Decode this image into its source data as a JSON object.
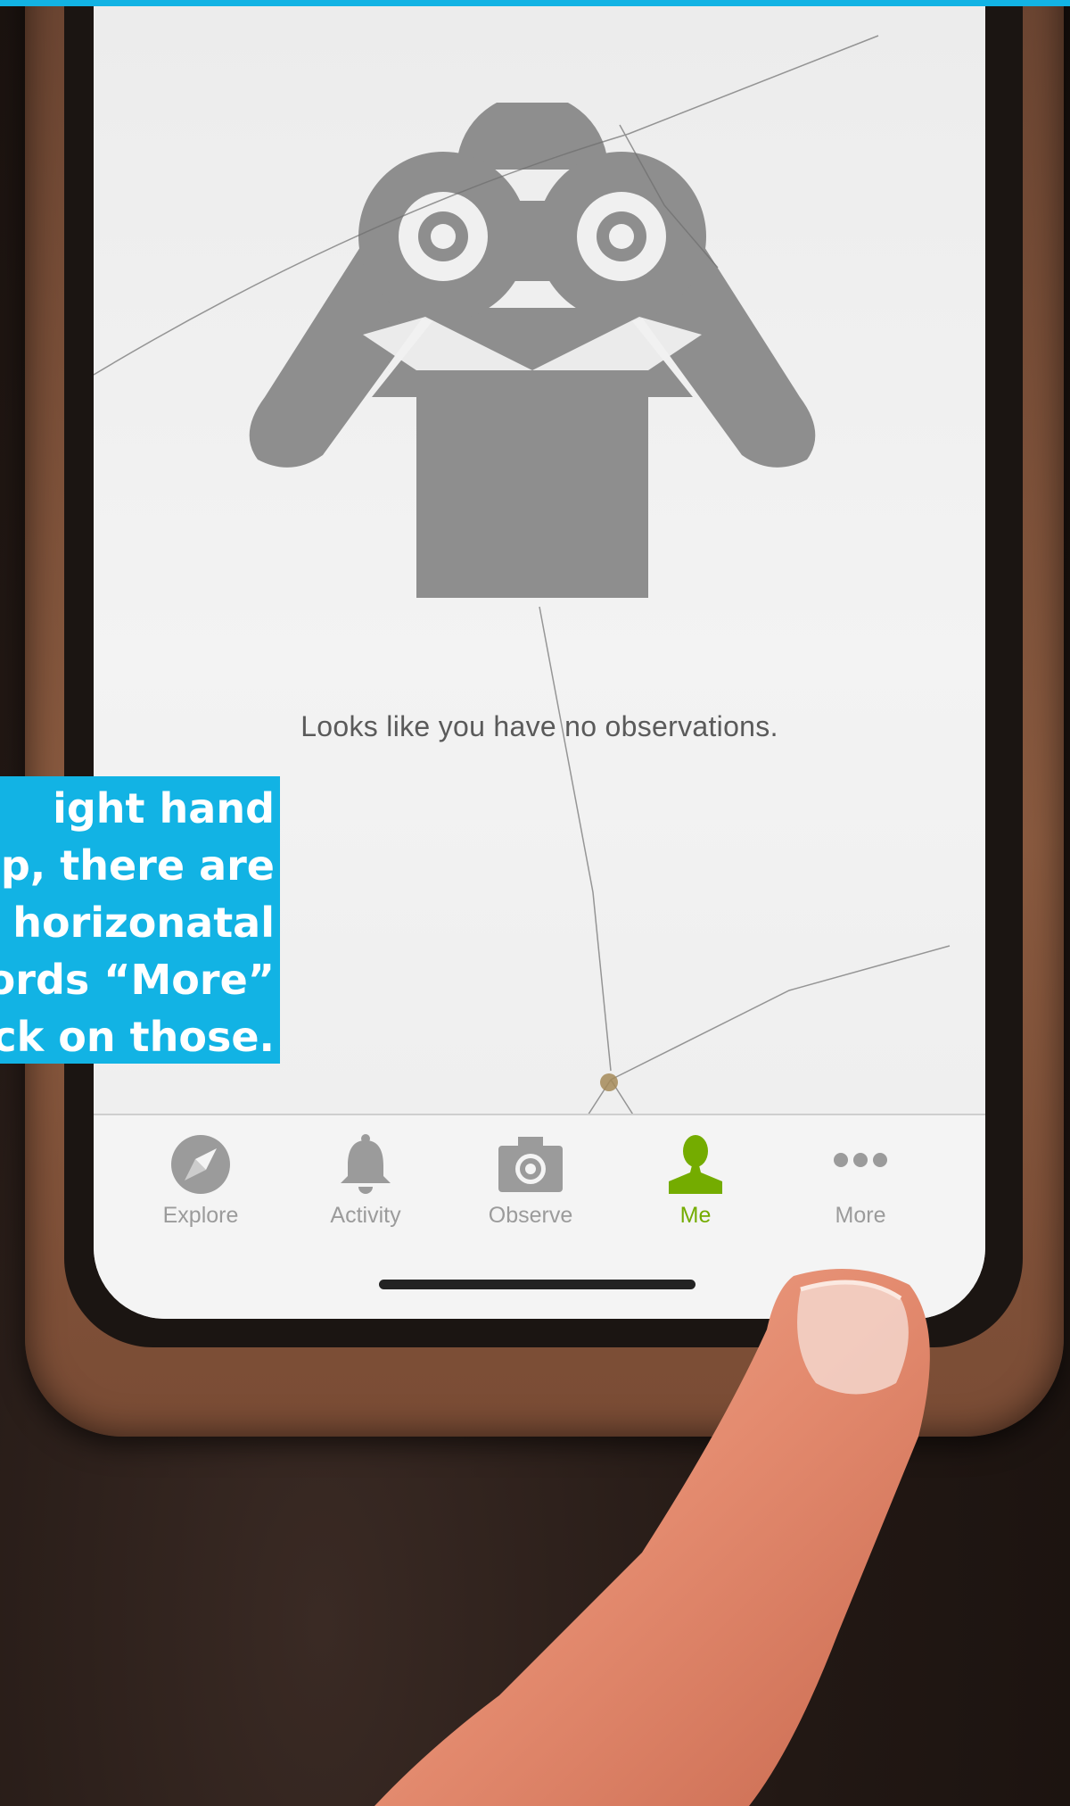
{
  "empty_state": {
    "message": "Looks like you have no observations.",
    "icon": "binoculars-person-icon"
  },
  "tab_bar": {
    "tabs": [
      {
        "label": "Explore",
        "icon": "compass-icon",
        "active": false
      },
      {
        "label": "Activity",
        "icon": "bell-icon",
        "active": false
      },
      {
        "label": "Observe",
        "icon": "camera-icon",
        "active": false
      },
      {
        "label": "Me",
        "icon": "person-icon",
        "active": true
      },
      {
        "label": "More",
        "icon": "three-dots-icon",
        "active": false
      }
    ]
  },
  "caption": {
    "lines": [
      "ight hand",
      "p, there are",
      "horizonatal",
      "ords “More”",
      "ck on those."
    ]
  },
  "colors": {
    "accent_blue": "#12b3e4",
    "active_tab_green": "#74ac00",
    "inactive_tab_gray": "#9b9b9b"
  }
}
